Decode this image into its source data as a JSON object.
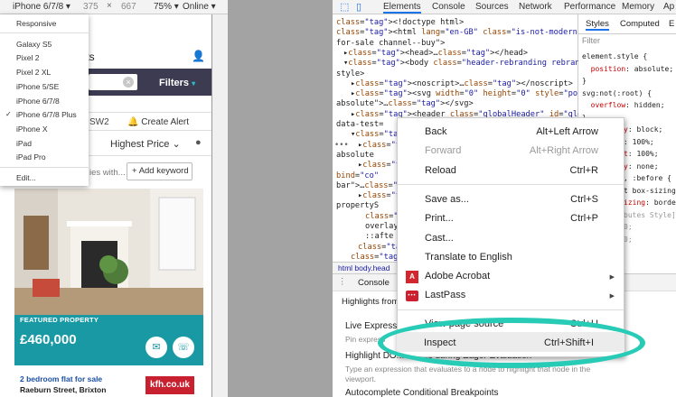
{
  "toolbar": {
    "device": "iPhone 6/7/8 ▾",
    "width": "375",
    "x": "×",
    "height": "667",
    "zoom": "75% ▾",
    "network": "Online ▾",
    "rotate_icon": "rotate-icon",
    "more": "⋮"
  },
  "device_menu": {
    "items": [
      "Responsive",
      "Galaxy S5",
      "Pixel 2",
      "Pixel 2 XL",
      "iPhone 5/SE",
      "iPhone 6/7/8",
      "iPhone 6/7/8 Plus",
      "iPhone X",
      "iPad",
      "iPad Pro",
      "Edit..."
    ],
    "checked": "✓"
  },
  "page": {
    "title_partial": "ults",
    "filters": "Filters",
    "area_partial": "SW2",
    "alert": "Create Alert",
    "sort": "Highest Price",
    "keywords_partial": "ies with...",
    "add_keyword": "Add keyword",
    "featured": "FEATURED PROPERTY",
    "price": "£460,000",
    "listing_title": "2 bedroom flat for sale",
    "listing_address": "Raeburn Street, Brixton",
    "agent_logo": "kfh.co.uk"
  },
  "devtools": {
    "tabs": [
      "Elements",
      "Console",
      "Sources",
      "Network",
      "Performance",
      "Memory",
      "Ap"
    ],
    "active_tab": "Elements",
    "breadcrumb": "html   body.head",
    "console_tab": "Console",
    "drawer": {
      "highlights": "Highlights from",
      "live": "Live Expressio",
      "pin": "Pin express",
      "highlight_dom": "Highlight DOM Nodes during Eager Evaluation",
      "highlight_desc1": "Type an expression that evaluates to a node to highlight that node in the",
      "highlight_desc2": "viewport.",
      "autocomplete": "Autocomplete Conditional Breakpoints"
    }
  },
  "elements": {
    "lines": [
      {
        "t": "<!doctype html>"
      },
      {
        "t": "<html lang=\"en-GB\" class=\"is-not-modern property-"
      },
      {
        "t": "for-sale channel--buy\">"
      },
      {
        "t": "▸<head>…</head>"
      },
      {
        "t": "▾<body class=\"header-rebranding rebranded-logo\""
      },
      {
        "t": "style>"
      },
      {
        "t": "▸<noscript>…</noscript>"
      },
      {
        "t": "▸<svg width=\"0\" height=\"0\" style=\"position:"
      },
      {
        "t": "absolute\">…</svg>"
      },
      {
        "t": "▸<header class=\"globalHeader\" id=\"globalHeader\""
      },
      {
        "t": "data-test="
      },
      {
        "t": "▾<div clas"
      },
      {
        "t": "▸<svg wi"
      },
      {
        "t": "absolute"
      },
      {
        "t": "▸<div id"
      },
      {
        "t": "bind=\"co"
      },
      {
        "t": "bar\">…</d"
      },
      {
        "t": "▸<div id"
      },
      {
        "t": "propertyS"
      },
      {
        "t": "<div da"
      },
      {
        "t": "overlay"
      },
      {
        "t": "::afte"
      },
      {
        "t": "</div>"
      },
      {
        "t": "</div>"
      }
    ]
  },
  "styles": {
    "tabs": [
      "Styles",
      "Computed",
      "E"
    ],
    "filter": "Filter",
    "lines": [
      "element.style {",
      "  position: absolute;",
      "}",
      "svg:not(:root) {",
      "  overflow: hidden;",
      "}",
      "y: block;",
      ": 100%;",
      "t: 100%;",
      "y: none;",
      ", :before {",
      "t box-sizing",
      "izing: border-",
      "butes Style]",
      "0;",
      "0;"
    ]
  },
  "context_menu": {
    "items": [
      {
        "label": "Back",
        "key": "Alt+Left Arrow"
      },
      {
        "label": "Forward",
        "key": "Alt+Right Arrow",
        "disabled": true
      },
      {
        "label": "Reload",
        "key": "Ctrl+R"
      },
      {
        "label": "Save as...",
        "key": "Ctrl+S"
      },
      {
        "label": "Print...",
        "key": "Ctrl+P"
      },
      {
        "label": "Cast..."
      },
      {
        "label": "Translate to English"
      },
      {
        "label": "Adobe Acrobat",
        "submenu": true
      },
      {
        "label": "LastPass",
        "submenu": true
      },
      {
        "label": "View page source",
        "key": "Ctrl+U"
      },
      {
        "label": "Inspect",
        "key": "Ctrl+Shift+I"
      }
    ]
  },
  "colors": {
    "accent": "#1899a4",
    "highlight_ring": "#28cbb6",
    "header_bg": "#3d3b52"
  }
}
